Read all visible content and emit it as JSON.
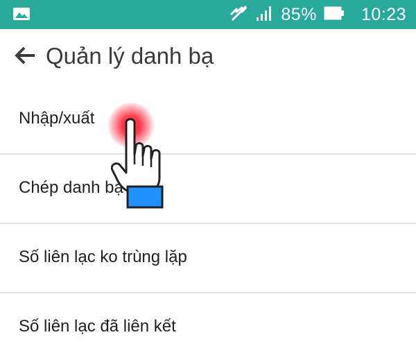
{
  "status_bar": {
    "left_icon": "image-icon",
    "icons": [
      "mute-icon",
      "signal-icon"
    ],
    "battery_percent": "85%",
    "battery_icon": "battery-icon",
    "time": "10:23",
    "background_color": "#29a99b"
  },
  "app_bar": {
    "back_icon": "arrow-left-icon",
    "title": "Quản lý danh bạ"
  },
  "menu": {
    "items": [
      {
        "label": "Nhập/xuất"
      },
      {
        "label": "Chép danh bạ"
      },
      {
        "label": "Số liên lạc ko trùng lặp"
      },
      {
        "label": "Số liên lạc đã liên kết"
      }
    ]
  },
  "overlay": {
    "tap_indicator_color": "#ff1428",
    "hand_icon": "hand-pointer-icon",
    "cuff_color": "#1e90ff"
  }
}
